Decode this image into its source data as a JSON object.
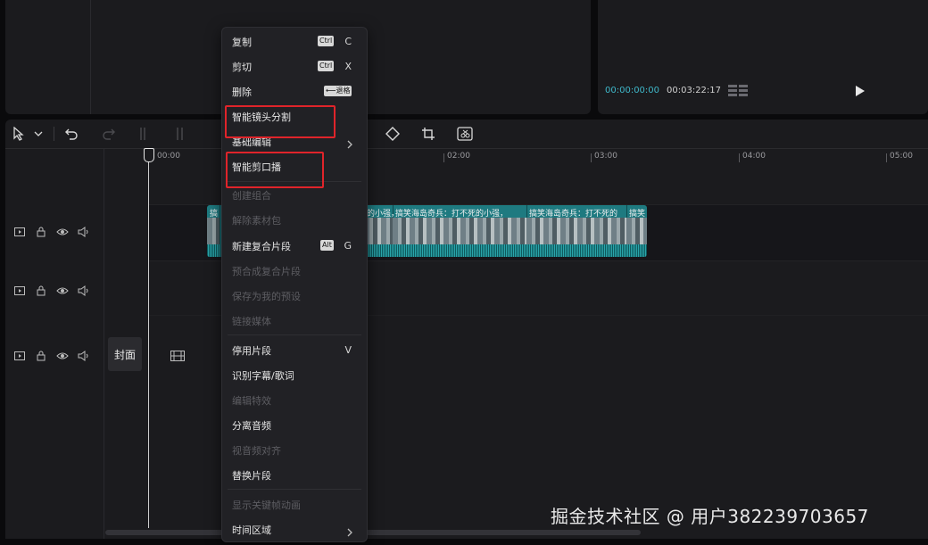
{
  "player": {
    "current_time": "00:00:00:00",
    "total_time": "00:03:22:17"
  },
  "timeline": {
    "ruler_ticks": [
      "00:00",
      "02:00",
      "03:00",
      "04:00",
      "05:00"
    ],
    "cover_label": "封面",
    "clip_segments": [
      "搞",
      "的小强，",
      "搞笑海岛奇兵：打不死的小强，",
      "搞笑海岛奇兵：打不死的",
      "搞笑"
    ]
  },
  "context_menu": {
    "items": [
      {
        "label": "复制",
        "key": "Ctrl",
        "letter": "C",
        "enabled": true
      },
      {
        "label": "剪切",
        "key": "Ctrl",
        "letter": "X",
        "enabled": true
      },
      {
        "label": "删除",
        "key": "⟵退格",
        "letter": "",
        "enabled": true
      },
      {
        "label": "智能镜头分割",
        "key": "",
        "letter": "",
        "enabled": true
      },
      {
        "label": "基础编辑",
        "key": "",
        "letter": "",
        "enabled": true,
        "submenu": true
      },
      {
        "label": "智能剪口播",
        "key": "",
        "letter": "",
        "enabled": true
      },
      {
        "label": "创建组合",
        "key": "",
        "letter": "",
        "enabled": false
      },
      {
        "label": "解除素材包",
        "key": "",
        "letter": "",
        "enabled": false
      },
      {
        "label": "新建复合片段",
        "key": "Alt",
        "letter": "G",
        "enabled": true
      },
      {
        "label": "预合成复合片段",
        "key": "",
        "letter": "",
        "enabled": false
      },
      {
        "label": "保存为我的预设",
        "key": "",
        "letter": "",
        "enabled": false
      },
      {
        "label": "链接媒体",
        "key": "",
        "letter": "",
        "enabled": false
      },
      {
        "label": "停用片段",
        "key": "",
        "letter": "V",
        "enabled": true
      },
      {
        "label": "识别字幕/歌词",
        "key": "",
        "letter": "",
        "enabled": true
      },
      {
        "label": "编辑特效",
        "key": "",
        "letter": "",
        "enabled": false
      },
      {
        "label": "分离音频",
        "key": "",
        "letter": "",
        "enabled": true
      },
      {
        "label": "视音频对齐",
        "key": "",
        "letter": "",
        "enabled": false
      },
      {
        "label": "替换片段",
        "key": "",
        "letter": "",
        "enabled": true
      },
      {
        "label": "显示关键帧动画",
        "key": "",
        "letter": "",
        "enabled": false
      },
      {
        "label": "时间区域",
        "key": "",
        "letter": "",
        "enabled": true,
        "submenu": true
      }
    ]
  },
  "watermark": "掘金技术社区 @ 用户382239703657",
  "colors": {
    "accent": "#3fb7c9",
    "highlight_box": "#e0242a",
    "clip": "#1e7a80"
  }
}
